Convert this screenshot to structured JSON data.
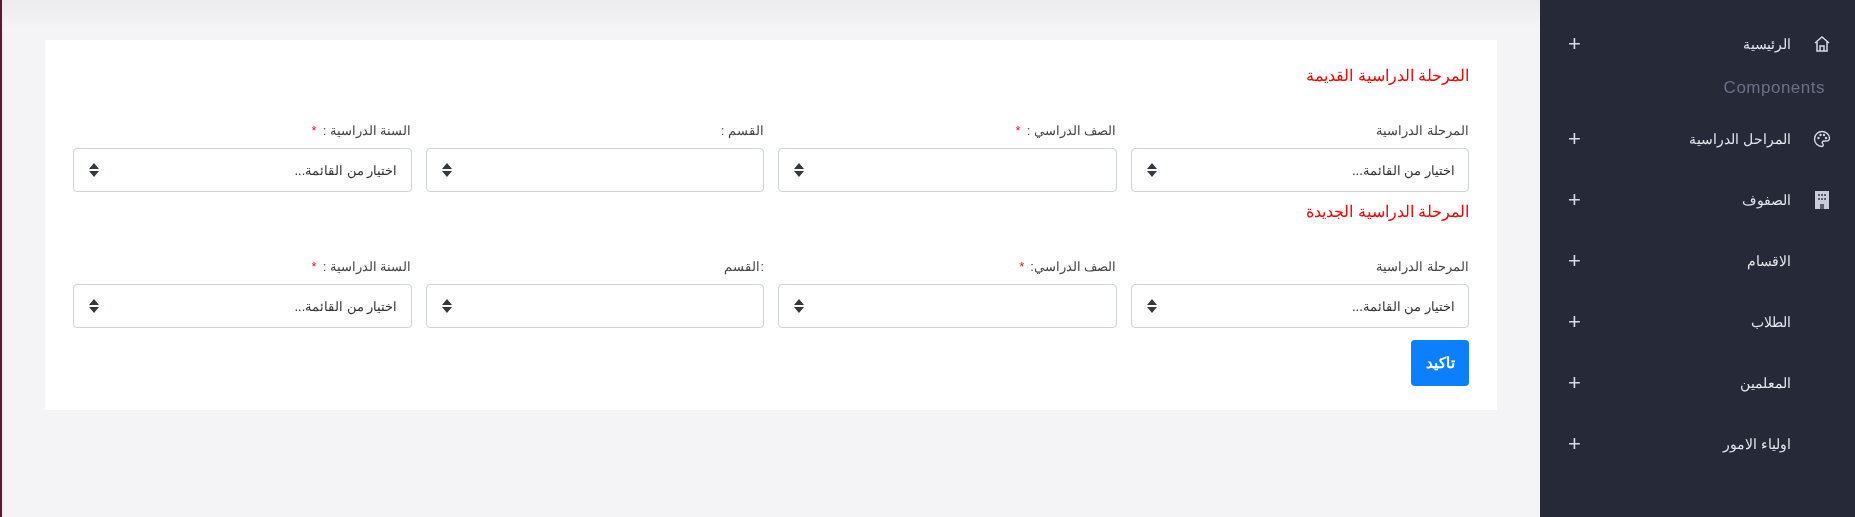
{
  "form_sections": [
    {
      "title": "المرحلة الدراسية القديمة",
      "fields": [
        {
          "label": "المرحلة الدراسية",
          "value": "اختيار من القائمة..."
        },
        {
          "label": "الصف الدراسي :",
          "required_mark": "*"
        },
        {
          "label": "القسم :"
        },
        {
          "label": "السنة الدراسية :",
          "required_mark": "*",
          "value": "اختيار من القائمة..."
        }
      ]
    },
    {
      "title": "المرحلة الدراسية الجديدة",
      "fields": [
        {
          "label": "المرحلة الدراسية",
          "value": "اختيار من القائمة..."
        },
        {
          "label": "الصف الدراسي:",
          "required_mark": "*"
        },
        {
          "label": ":القسم"
        },
        {
          "label": "السنة الدراسية :",
          "required_mark": "*",
          "value": "اختيار من القائمة..."
        }
      ]
    }
  ],
  "submit_button": "تاكيد",
  "sidebar": {
    "items": [
      {
        "kind": "home",
        "label": "الرئيسية",
        "expand": "+"
      },
      {
        "kind": "heading",
        "label": "Components"
      },
      {
        "kind": "palette",
        "label": "المراحل الدراسية",
        "expand": "+"
      },
      {
        "kind": "building",
        "label": "الصفوف",
        "expand": "+"
      },
      {
        "kind": "plain",
        "label": "الاقسام",
        "expand": "+"
      },
      {
        "kind": "plain",
        "label": "الطلاب",
        "expand": "+"
      },
      {
        "kind": "plain",
        "label": "المعلمين",
        "expand": "+"
      },
      {
        "kind": "plain",
        "label": "اولياء الامور",
        "expand": "+"
      }
    ]
  }
}
